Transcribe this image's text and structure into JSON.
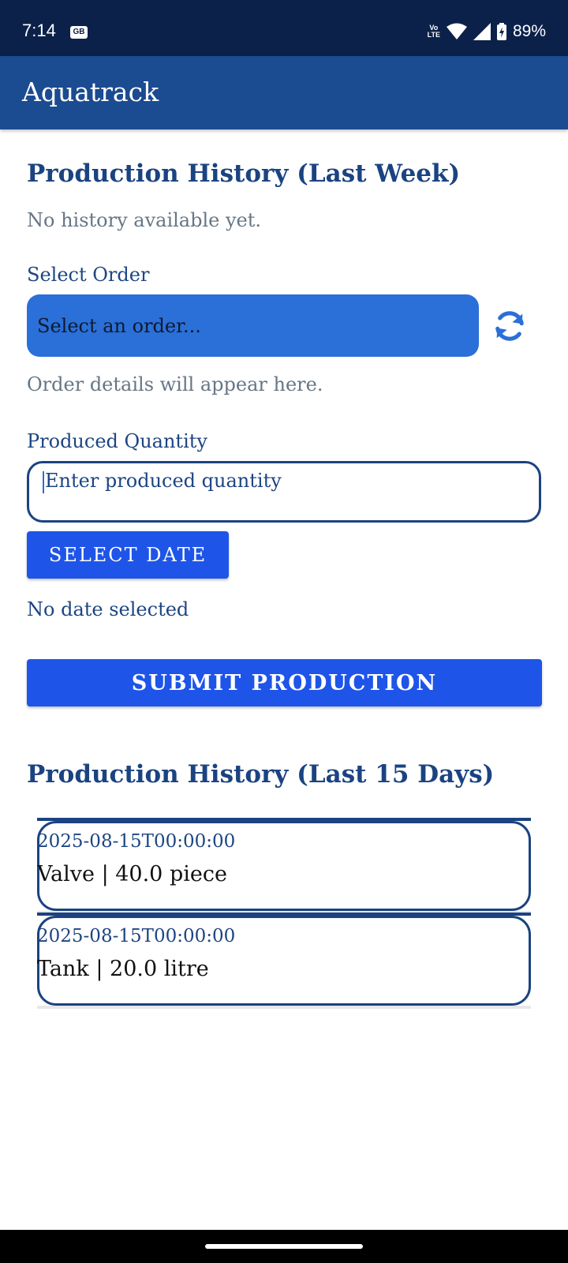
{
  "status_bar": {
    "time": "7:14",
    "notification_badge": "GB",
    "network_label_top": "Vo",
    "network_label_bottom": "LTE",
    "battery": "89%"
  },
  "app_bar": {
    "title": "Aquatrack"
  },
  "last_week": {
    "heading": "Production History (Last Week)",
    "empty_text": "No history available yet."
  },
  "order": {
    "label": "Select Order",
    "dropdown_value": "Select an order...",
    "details_placeholder": "Order details will appear here."
  },
  "quantity": {
    "label": "Produced Quantity",
    "placeholder": "Enter produced quantity"
  },
  "date": {
    "button_label": "SELECT DATE",
    "status_text": "No date selected"
  },
  "submit": {
    "button_label": "SUBMIT PRODUCTION"
  },
  "last_15_days": {
    "heading": "Production History (Last 15 Days)",
    "items": [
      {
        "date": "2025-08-15T00:00:00",
        "detail": "Valve | 40.0 piece"
      },
      {
        "date": "2025-08-15T00:00:00",
        "detail": "Tank | 20.0 litre"
      }
    ]
  },
  "colors": {
    "status_bar": "#0b2149",
    "app_bar": "#1b4b91",
    "heading": "#1b4381",
    "dropdown": "#2b6fd8",
    "button": "#1e55e8"
  }
}
